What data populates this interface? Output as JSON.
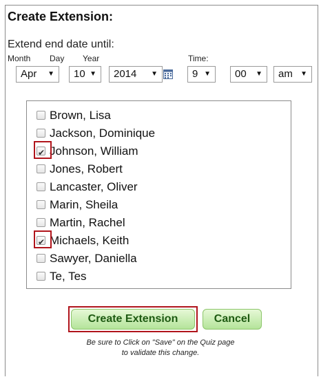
{
  "title": "Create Extension:",
  "extend_label": "Extend end date until:",
  "labels": {
    "month": "Month",
    "day": "Day",
    "year": "Year",
    "time": "Time:"
  },
  "selects": {
    "month": "Apr",
    "day": "10",
    "year": "2014",
    "hour": "9",
    "minute": "00",
    "ampm": "am",
    "arrow": "▼"
  },
  "students": [
    {
      "name": "Brown, Lisa",
      "checked": false
    },
    {
      "name": "Jackson, Dominique",
      "checked": false
    },
    {
      "name": "Johnson, William",
      "checked": true
    },
    {
      "name": "Jones, Robert",
      "checked": false
    },
    {
      "name": "Lancaster, Oliver",
      "checked": false
    },
    {
      "name": "Marin, Sheila",
      "checked": false
    },
    {
      "name": "Martin, Rachel",
      "checked": false
    },
    {
      "name": "Michaels, Keith",
      "checked": true
    },
    {
      "name": "Sawyer, Daniella",
      "checked": false
    },
    {
      "name": "Te, Tes",
      "checked": false
    }
  ],
  "buttons": {
    "create": "Create Extension",
    "cancel": "Cancel"
  },
  "note": {
    "line1": "Be sure to Click on \"Save\" on the Quiz page",
    "line2": "to validate this change."
  },
  "colors": {
    "highlight": "#b0141b",
    "button_text": "#1e5a12",
    "button_bg": "#c8eeb0"
  },
  "icons": {
    "calendar": "calendar-icon",
    "dropdown": "chevron-down-icon",
    "check": "checkbox-checked-icon"
  }
}
